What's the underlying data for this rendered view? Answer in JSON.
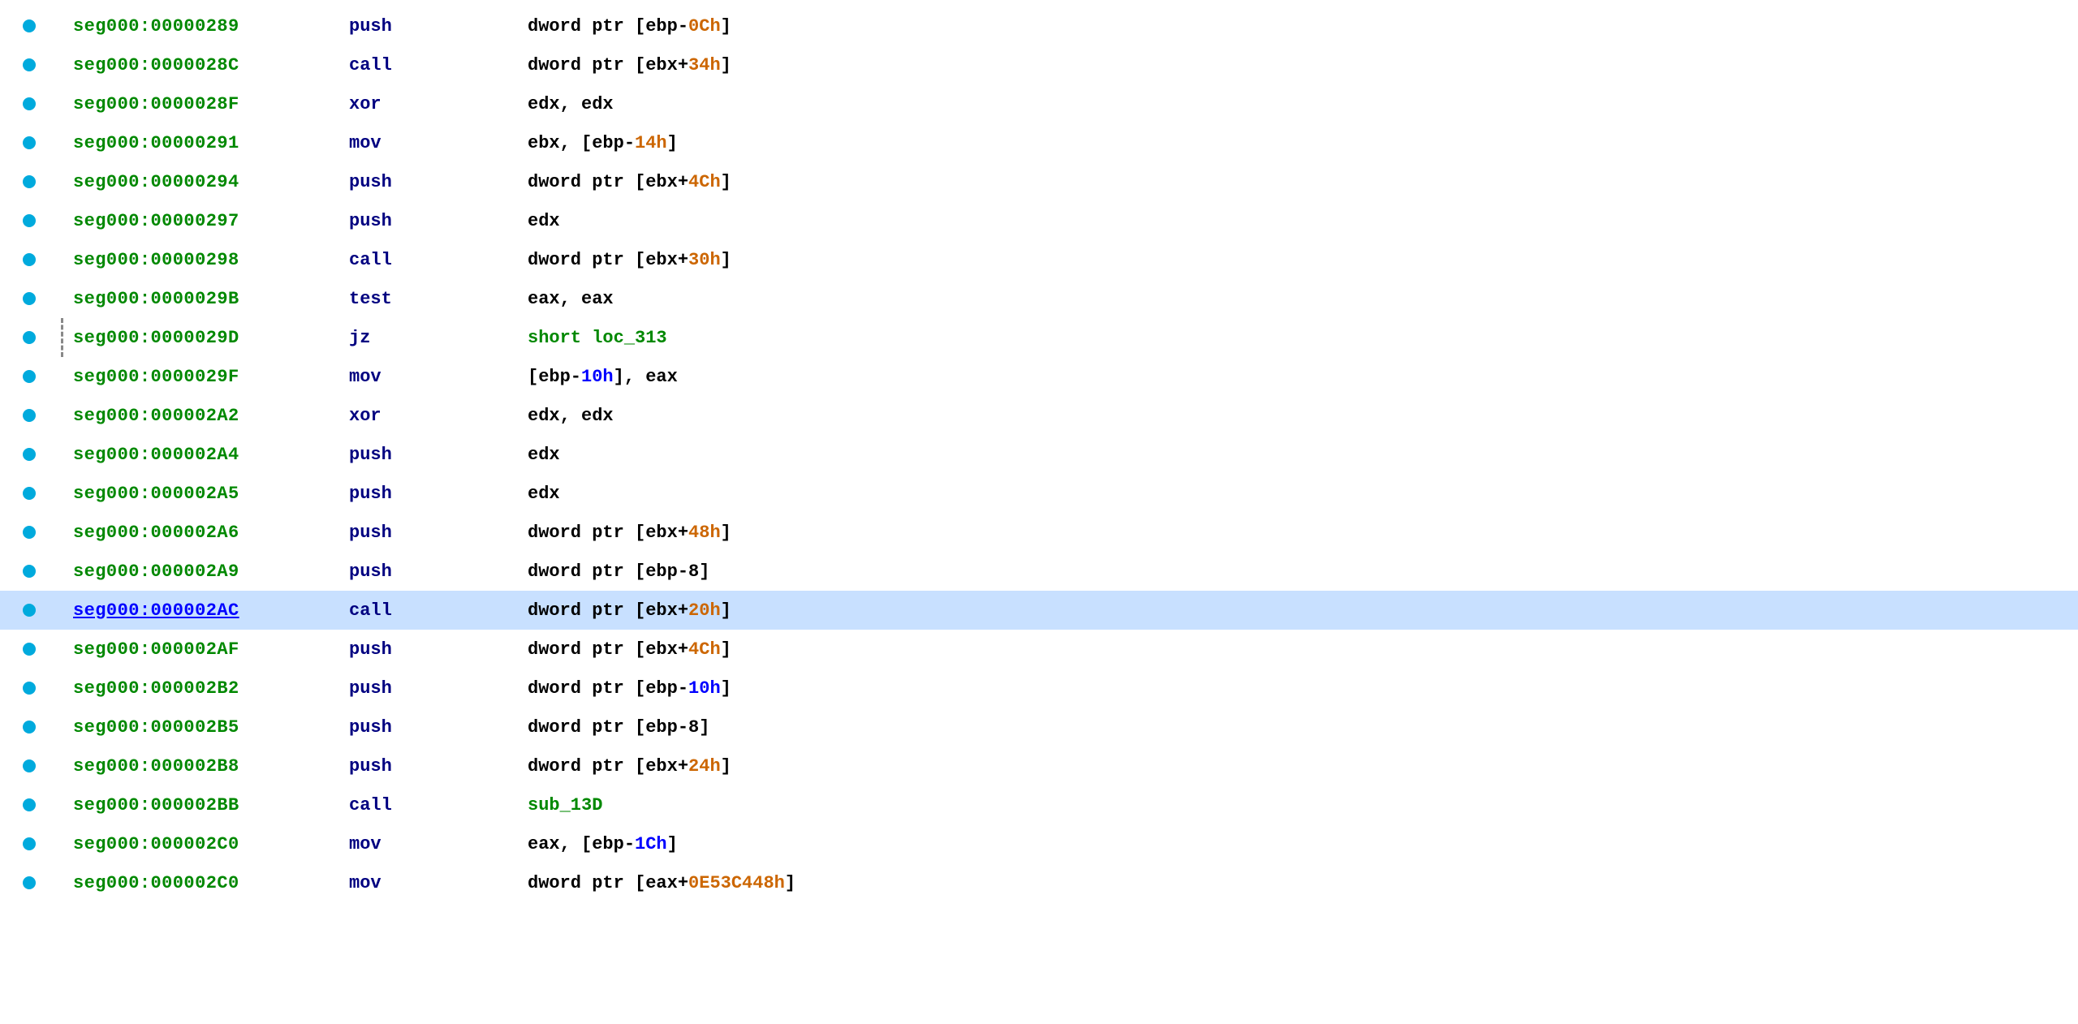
{
  "rows": [
    {
      "id": "row-289",
      "bullet": true,
      "dashed": false,
      "addr": "seg000:00000289",
      "addr_active": false,
      "mnemonic": "push",
      "operand_parts": [
        {
          "text": "dword ptr [ebp-",
          "cls": "op-black"
        },
        {
          "text": "0Ch",
          "cls": "op-orange"
        },
        {
          "text": "]",
          "cls": "op-black"
        }
      ]
    },
    {
      "id": "row-28C",
      "bullet": true,
      "dashed": false,
      "addr": "seg000:0000028C",
      "addr_active": false,
      "mnemonic": "call",
      "operand_parts": [
        {
          "text": "dword ptr [ebx+",
          "cls": "op-black"
        },
        {
          "text": "34h",
          "cls": "op-orange"
        },
        {
          "text": "]",
          "cls": "op-black"
        }
      ]
    },
    {
      "id": "row-28F",
      "bullet": true,
      "dashed": false,
      "addr": "seg000:0000028F",
      "addr_active": false,
      "mnemonic": "xor",
      "operand_parts": [
        {
          "text": "edx, edx",
          "cls": "op-black"
        }
      ]
    },
    {
      "id": "row-291",
      "bullet": true,
      "dashed": false,
      "addr": "seg000:00000291",
      "addr_active": false,
      "mnemonic": "mov",
      "operand_parts": [
        {
          "text": "ebx, [ebp-",
          "cls": "op-black"
        },
        {
          "text": "14h",
          "cls": "op-orange"
        },
        {
          "text": "]",
          "cls": "op-black"
        }
      ]
    },
    {
      "id": "row-294",
      "bullet": true,
      "dashed": false,
      "addr": "seg000:00000294",
      "addr_active": false,
      "mnemonic": "push",
      "operand_parts": [
        {
          "text": "dword ptr [ebx+",
          "cls": "op-black"
        },
        {
          "text": "4Ch",
          "cls": "op-orange"
        },
        {
          "text": "]",
          "cls": "op-black"
        }
      ]
    },
    {
      "id": "row-297",
      "bullet": true,
      "dashed": false,
      "addr": "seg000:00000297",
      "addr_active": false,
      "mnemonic": "push",
      "operand_parts": [
        {
          "text": "edx",
          "cls": "op-black"
        }
      ]
    },
    {
      "id": "row-298",
      "bullet": true,
      "dashed": false,
      "addr": "seg000:00000298",
      "addr_active": false,
      "mnemonic": "call",
      "operand_parts": [
        {
          "text": "dword ptr [ebx+",
          "cls": "op-black"
        },
        {
          "text": "30h",
          "cls": "op-orange"
        },
        {
          "text": "]",
          "cls": "op-black"
        }
      ]
    },
    {
      "id": "row-29B",
      "bullet": true,
      "dashed": false,
      "addr": "seg000:0000029B",
      "addr_active": false,
      "mnemonic": "test",
      "operand_parts": [
        {
          "text": "eax, eax",
          "cls": "op-black"
        }
      ]
    },
    {
      "id": "row-29D",
      "bullet": true,
      "dashed": true,
      "addr": "seg000:0000029D",
      "addr_active": false,
      "mnemonic": "jz",
      "operand_parts": [
        {
          "text": "short loc_313",
          "cls": "op-green"
        }
      ]
    },
    {
      "id": "row-29F",
      "bullet": true,
      "dashed": false,
      "addr": "seg000:0000029F",
      "addr_active": false,
      "mnemonic": "mov",
      "operand_parts": [
        {
          "text": "[ebp-",
          "cls": "op-black"
        },
        {
          "text": "10h",
          "cls": "op-blue"
        },
        {
          "text": "], eax",
          "cls": "op-black"
        }
      ]
    },
    {
      "id": "row-2A2",
      "bullet": true,
      "dashed": false,
      "addr": "seg000:000002A2",
      "addr_active": false,
      "mnemonic": "xor",
      "operand_parts": [
        {
          "text": "edx, edx",
          "cls": "op-black"
        }
      ]
    },
    {
      "id": "row-2A4",
      "bullet": true,
      "dashed": false,
      "addr": "seg000:000002A4",
      "addr_active": false,
      "mnemonic": "push",
      "operand_parts": [
        {
          "text": "edx",
          "cls": "op-black"
        }
      ]
    },
    {
      "id": "row-2A5",
      "bullet": true,
      "dashed": false,
      "addr": "seg000:000002A5",
      "addr_active": false,
      "mnemonic": "push",
      "operand_parts": [
        {
          "text": "edx",
          "cls": "op-black"
        }
      ]
    },
    {
      "id": "row-2A6",
      "bullet": true,
      "dashed": false,
      "addr": "seg000:000002A6",
      "addr_active": false,
      "mnemonic": "push",
      "operand_parts": [
        {
          "text": "dword ptr [ebx+",
          "cls": "op-black"
        },
        {
          "text": "48h",
          "cls": "op-orange"
        },
        {
          "text": "]",
          "cls": "op-black"
        }
      ]
    },
    {
      "id": "row-2A9",
      "bullet": true,
      "dashed": false,
      "addr": "seg000:000002A9",
      "addr_active": false,
      "mnemonic": "push",
      "operand_parts": [
        {
          "text": "dword ptr [ebp-8]",
          "cls": "op-black"
        }
      ]
    },
    {
      "id": "row-2AC",
      "bullet": true,
      "dashed": false,
      "addr": "seg000:000002AC",
      "addr_active": true,
      "mnemonic": "call",
      "operand_parts": [
        {
          "text": "dword ptr [ebx+",
          "cls": "op-black"
        },
        {
          "text": "20h",
          "cls": "op-orange"
        },
        {
          "text": "]",
          "cls": "op-black"
        }
      ]
    },
    {
      "id": "row-2AF",
      "bullet": true,
      "dashed": false,
      "addr": "seg000:000002AF",
      "addr_active": false,
      "mnemonic": "push",
      "operand_parts": [
        {
          "text": "dword ptr [ebx+",
          "cls": "op-black"
        },
        {
          "text": "4Ch",
          "cls": "op-orange"
        },
        {
          "text": "]",
          "cls": "op-black"
        }
      ]
    },
    {
      "id": "row-2B2",
      "bullet": true,
      "dashed": false,
      "addr": "seg000:000002B2",
      "addr_active": false,
      "mnemonic": "push",
      "operand_parts": [
        {
          "text": "dword ptr [ebp-",
          "cls": "op-black"
        },
        {
          "text": "10h",
          "cls": "op-blue"
        },
        {
          "text": "]",
          "cls": "op-black"
        }
      ]
    },
    {
      "id": "row-2B5",
      "bullet": true,
      "dashed": false,
      "addr": "seg000:000002B5",
      "addr_active": false,
      "mnemonic": "push",
      "operand_parts": [
        {
          "text": "dword ptr [ebp-8]",
          "cls": "op-black"
        }
      ]
    },
    {
      "id": "row-2B8",
      "bullet": true,
      "dashed": false,
      "addr": "seg000:000002B8",
      "addr_active": false,
      "mnemonic": "push",
      "operand_parts": [
        {
          "text": "dword ptr [ebx+",
          "cls": "op-black"
        },
        {
          "text": "24h",
          "cls": "op-orange"
        },
        {
          "text": "]",
          "cls": "op-black"
        }
      ]
    },
    {
      "id": "row-2BB",
      "bullet": true,
      "dashed": false,
      "addr": "seg000:000002BB",
      "addr_active": false,
      "mnemonic": "call",
      "operand_parts": [
        {
          "text": "sub_13D",
          "cls": "op-green"
        }
      ]
    },
    {
      "id": "row-2C0",
      "bullet": true,
      "dashed": false,
      "addr": "seg000:000002C0",
      "addr_active": false,
      "mnemonic": "mov",
      "operand_parts": [
        {
          "text": "eax, [ebp-",
          "cls": "op-black"
        },
        {
          "text": "1Ch",
          "cls": "op-blue"
        },
        {
          "text": "]",
          "cls": "op-black"
        }
      ]
    },
    {
      "id": "row-last",
      "bullet": true,
      "dashed": false,
      "addr": "seg000:000002C0",
      "addr_active": false,
      "mnemonic": "mov",
      "operand_parts": [
        {
          "text": "dword ptr [eax+",
          "cls": "op-black"
        },
        {
          "text": "0E53C448h",
          "cls": "op-orange"
        },
        {
          "text": "]",
          "cls": "op-black"
        }
      ]
    }
  ]
}
